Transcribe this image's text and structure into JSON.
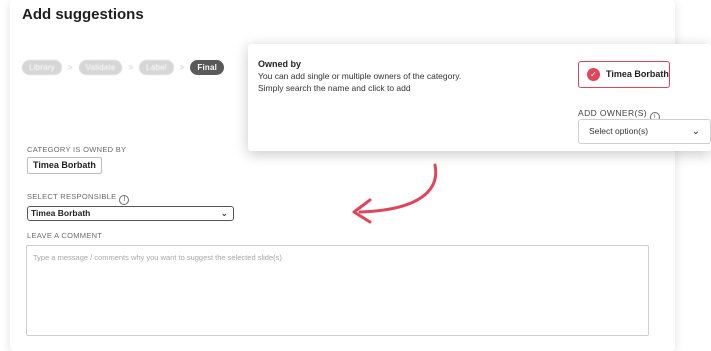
{
  "title": "Add suggestions",
  "steps": [
    {
      "label": "Library",
      "active": false
    },
    {
      "label": "Validate",
      "active": false
    },
    {
      "label": "Label",
      "active": false
    },
    {
      "label": "Final",
      "active": true
    }
  ],
  "category_owned": {
    "label": "CATEGORY IS OWNED BY",
    "owner": "Timea Borbath"
  },
  "select_responsible": {
    "label": "SELECT RESPONSIBLE",
    "value": "Timea Borbath"
  },
  "comment": {
    "label": "LEAVE A COMMENT",
    "placeholder": "Type a message / comments why you want to suggest the selected slide(s)"
  },
  "popup": {
    "title": "Owned by",
    "line1": "You can add single or multiple owners of the category.",
    "line2": "Simply search the name and click to add",
    "selected_owner": "Timea Borbath",
    "add_owner_label": "ADD OWNER(S)",
    "select_placeholder": "Select option(s)"
  },
  "colors": {
    "accent": "#e0455a",
    "step_active": "#5a5a5a"
  },
  "icons": {
    "info": "info-icon",
    "chevron": "chevron-down-icon",
    "check": "check-circle-icon",
    "annotation": "curved-arrow-icon"
  }
}
